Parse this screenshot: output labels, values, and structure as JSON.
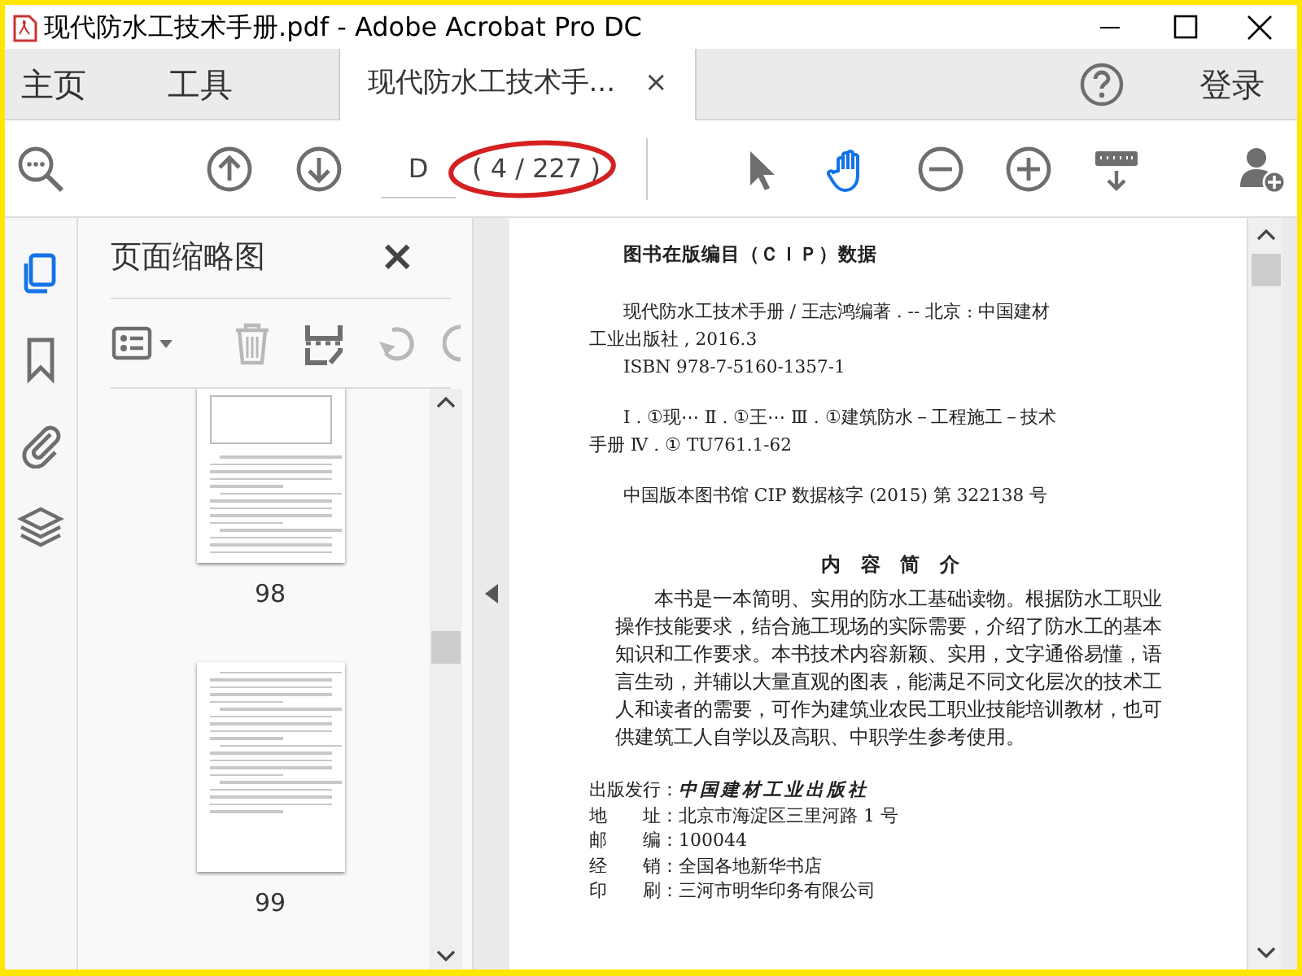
{
  "window": {
    "title": "现代防水工技术手册.pdf - Adobe Acrobat Pro DC"
  },
  "nav_tabs": [
    {
      "label": "主页",
      "selected": false
    },
    {
      "label": "工具",
      "selected": false
    },
    {
      "label": "现代防水工技术手...",
      "selected": true,
      "close": "×"
    }
  ],
  "sign_in": "登录",
  "toolbar": {
    "page_field": "D",
    "page_count": "( 4 / 227 )",
    "highlighted": true,
    "tools": [
      {
        "kind": "pointer",
        "selected": false
      },
      {
        "kind": "hand",
        "selected": true
      },
      {
        "kind": "zoom_out",
        "selected": false
      },
      {
        "kind": "zoom_in",
        "selected": false
      },
      {
        "kind": "keyboard",
        "selected": false
      }
    ]
  },
  "rail": [
    {
      "kind": "pages",
      "selected": true
    },
    {
      "kind": "bookmark",
      "selected": false
    },
    {
      "kind": "attachment",
      "selected": false
    },
    {
      "kind": "layers",
      "selected": false
    }
  ],
  "panel": {
    "title": "页面缩略图",
    "close": "×",
    "tools": [
      {
        "kind": "options",
        "disabled": false
      },
      {
        "kind": "delete",
        "disabled": true
      },
      {
        "kind": "extract",
        "disabled": false
      },
      {
        "kind": "rotate",
        "disabled": true
      },
      {
        "kind": "rotate_right",
        "disabled": true
      }
    ],
    "thumbnails": [
      {
        "label": "98",
        "cut": true
      },
      {
        "label": "99",
        "cut": false
      }
    ]
  },
  "document": {
    "cip_heading": "图书在版编目（ＣＩＰ）数据",
    "cip": [
      "现代防水工技术手册 / 王志鸿编著 . -- 北京 : 中国建材工业出版社 , 2016.3",
      "ISBN 978-7-5160-1357-1",
      "Ⅰ . ①现⋯ Ⅱ . ①王⋯ Ⅲ . ①建筑防水－工程施工－技术手册 Ⅳ . ① TU761.1-62",
      "中国版本图书馆 CIP 数据核字 (2015) 第 322138 号"
    ],
    "summary_heading": "内 容 简 介",
    "summary": "本书是一本简明、实用的防水工基础读物。根据防水工职业操作技能要求，结合施工现场的实际需要，介绍了防水工的基本知识和工作要求。本书技术内容新颖、实用，文字通俗易懂，语言生动，并辅以大量直观的图表，能满足不同文化层次的技术工人和读者的需要，可作为建筑业农民工职业技能培训教材，也可供建筑工人自学以及高职、中职学生参考使用。",
    "imprint": [
      {
        "label": "出版发行：",
        "value": "中国建材工业出版社",
        "script": true
      },
      {
        "label": "地　　址：",
        "value": "北京市海淀区三里河路 1 号",
        "script": false
      },
      {
        "label": "邮　　编：",
        "value": "100044",
        "script": false
      },
      {
        "label": "经　　销：",
        "value": "全国各地新华书店",
        "script": false
      },
      {
        "label": "印　　刷：",
        "value": "三河市明华印务有限公司",
        "script": false
      }
    ]
  }
}
